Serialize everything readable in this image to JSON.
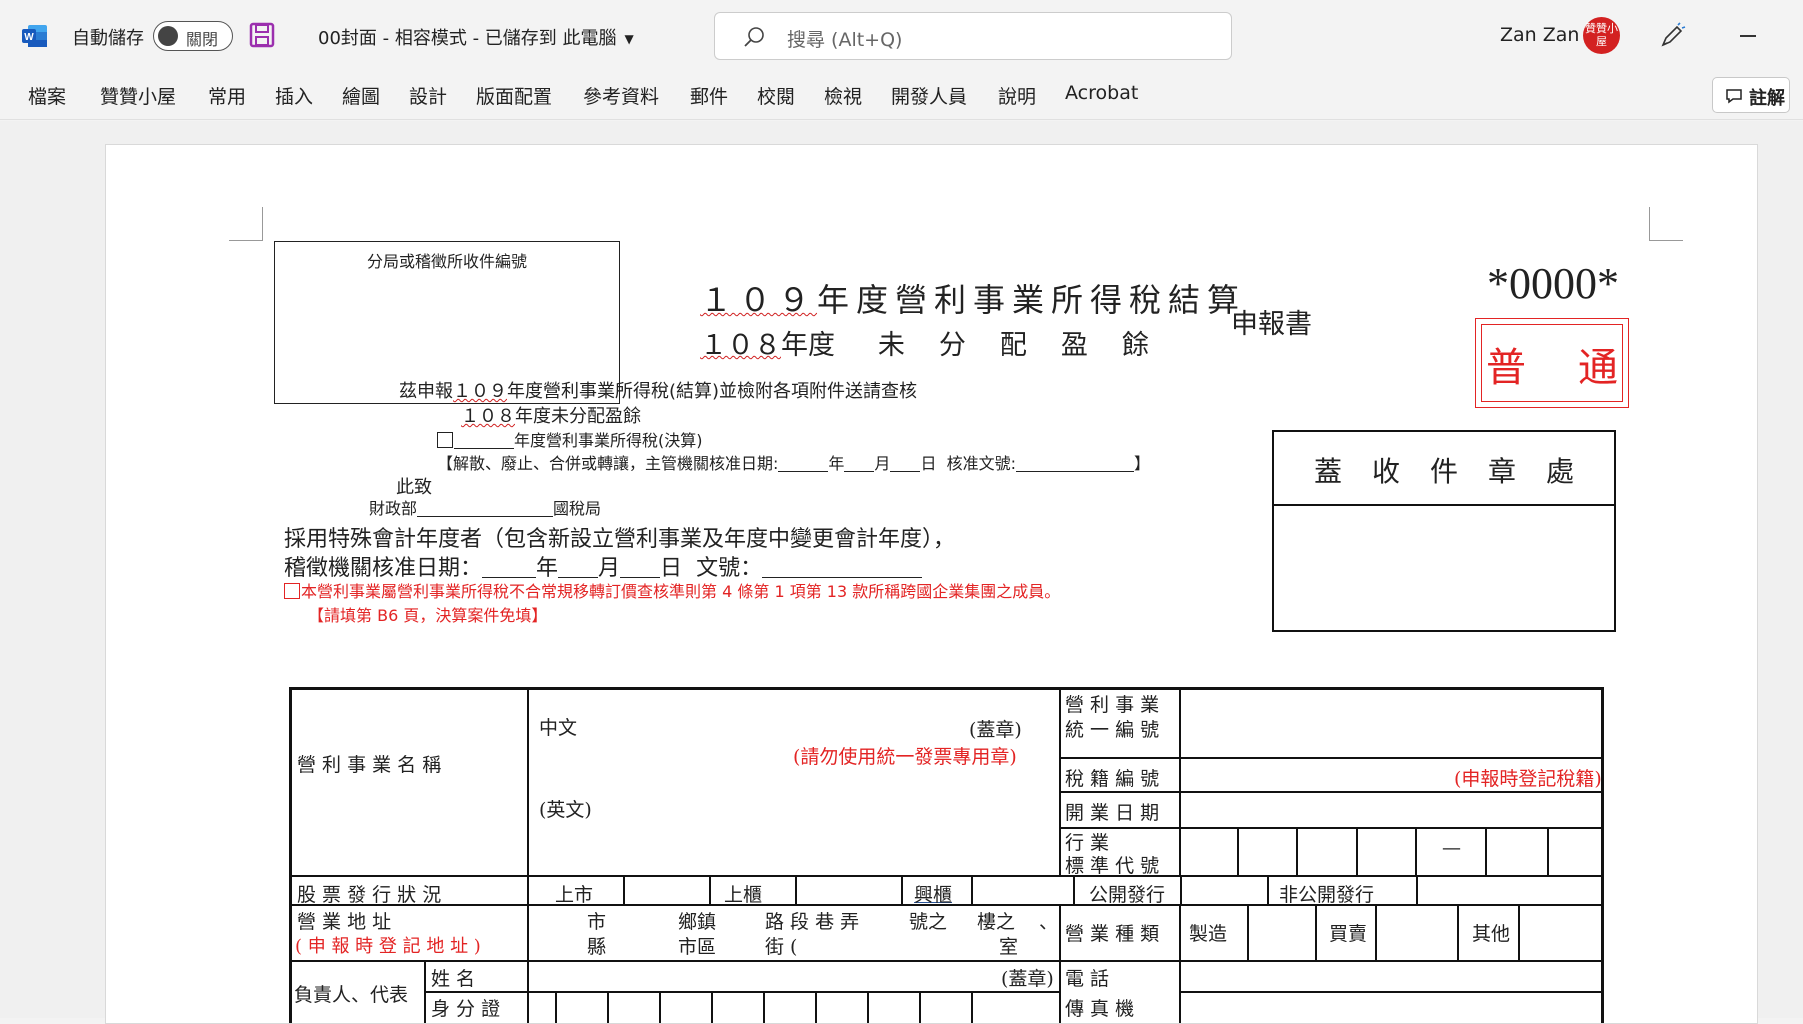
{
  "titlebar": {
    "autosave_label": "自動儲存",
    "autosave_state": "關閉",
    "doc_title": "00封面  -  相容模式  -  已儲存到 此電腦",
    "search_placeholder": "搜尋 (Alt+Q)",
    "user_name": "Zan Zan",
    "avatar_text": "贊贊小屋",
    "brand_color": "#2b579a"
  },
  "ribbon": {
    "tabs": [
      "檔案",
      "贊贊小屋",
      "常用",
      "插入",
      "繪圖",
      "設計",
      "版面配置",
      "參考資料",
      "郵件",
      "校閱",
      "檢視",
      "開發人員",
      "說明",
      "Acrobat"
    ],
    "comment_label": "註解"
  },
  "document": {
    "receipt_box_label": "分局或稽徵所收件編號",
    "title_year1": "１０９",
    "title_line1_text": "年度營利事業所得稅結算",
    "title_year2": "１０８",
    "title_line2_a": "年度",
    "title_line2_b": "未分配盈餘",
    "title_side": "申報書",
    "doc_code": "*0000*",
    "stamp_left": "普",
    "stamp_right": "通",
    "seal_box_header": "蓋收件章處",
    "decl_1a": "茲申報",
    "decl_1_year": "１０９",
    "decl_1b": "年度營利事業所得稅(結算)並檢附各項附件送請查核",
    "decl_2_year": "１０８",
    "decl_2b": "年度未分配盈餘",
    "decl_3": "年度營利事業所得稅(決算)",
    "decl_4a": "【解散、廢止、合併或轉讓，主管機關核准日期:",
    "decl_4_year": "年",
    "decl_4_month": "月",
    "decl_4_day": "日",
    "decl_4_ref": "核准文號:",
    "decl_4_end": "】",
    "decl_5": "此致",
    "decl_6a": "財政部",
    "decl_6b": "國稅局",
    "special_1": "採用特殊會計年度者（包含新設立營利事業及年度中變更會計年度），",
    "special_2a": "稽徵機關核准日期：",
    "special_2_year": "年",
    "special_2_month": "月",
    "special_2_day": "日",
    "special_2_ref": "文號：",
    "red_note_1": "本營利事業屬營利事業所得稅不合常規移轉訂價查核準則第 4 條第 1 項第 13 款所稱跨國企業集團之成員。",
    "red_note_2": "【請填第 B6 頁，決算案件免填】"
  },
  "form": {
    "name_label": "營 利 事 業 名 稱",
    "chinese_label": "中文",
    "seal_label": "(蓋章)",
    "seal_note": "(請勿使用統一發票專用章)",
    "english_label": "(英文)",
    "uniform_no_1": "營 利 事 業",
    "uniform_no_2": "統 一 編 號",
    "tax_reg_no": "稅 籍 編 號",
    "tax_reg_note": "(申報時登記稅籍)",
    "open_date": "開 業 日 期",
    "industry_code_1": "行       業",
    "industry_code_2": "標 準 代 號",
    "industry_dash": "—",
    "stock_label": "股 票 發 行 狀 況",
    "stock_options": [
      "上市",
      "上櫃",
      "興櫃",
      "公開發行",
      "非公開發行"
    ],
    "address_label_1": "營   業   地   址",
    "address_label_2": "( 申 報 時 登 記 地 址 )",
    "addr_city": "市",
    "addr_county": "縣",
    "addr_township": "鄉鎮",
    "addr_district": "市區",
    "addr_road": "路 段 巷 弄",
    "addr_street": "街 (",
    "addr_no": "號之",
    "addr_floor": "樓之",
    "addr_room": "室",
    "addr_comma": "、",
    "business_type": "營 業 種 類",
    "biz_options": [
      "製造",
      "買賣",
      "其他"
    ],
    "rep_label": "負責人、代表",
    "rep_name": "姓        名",
    "rep_seal": "(蓋章)",
    "phone": "電        話",
    "rep_id": "身 分 證",
    "fax": "傳 真 機"
  }
}
